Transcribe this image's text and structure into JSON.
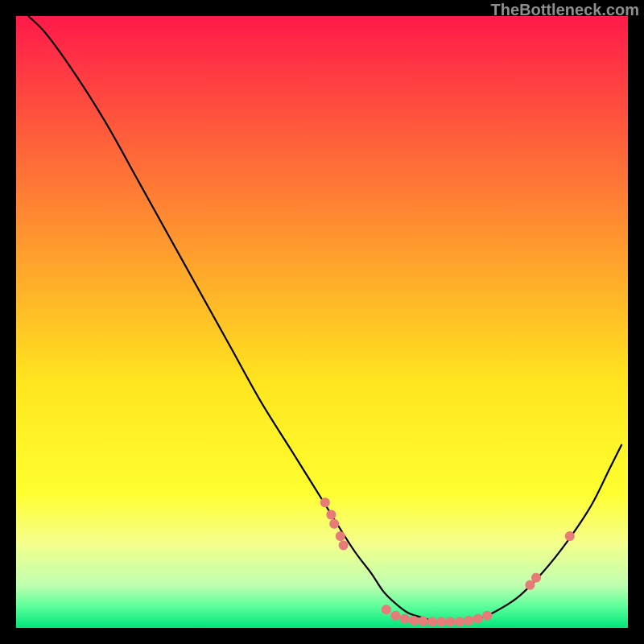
{
  "watermark": "TheBottleneck.com",
  "chart_data": {
    "type": "line",
    "title": "",
    "xlabel": "",
    "ylabel": "",
    "xlim": [
      0,
      100
    ],
    "ylim": [
      0,
      100
    ],
    "grid": false,
    "legend": false,
    "background_gradient": {
      "stops": [
        {
          "offset": 0.0,
          "color": "#ff1a4a"
        },
        {
          "offset": 0.2,
          "color": "#ff5f3a"
        },
        {
          "offset": 0.4,
          "color": "#ffa22c"
        },
        {
          "offset": 0.6,
          "color": "#ffe61e"
        },
        {
          "offset": 0.78,
          "color": "#ffff30"
        },
        {
          "offset": 0.86,
          "color": "#f5ff8a"
        },
        {
          "offset": 0.93,
          "color": "#c0ffb0"
        },
        {
          "offset": 0.965,
          "color": "#5cff9c"
        },
        {
          "offset": 1.0,
          "color": "#00e57a"
        }
      ]
    },
    "series": [
      {
        "name": "bottleneck-curve",
        "color": "#000000",
        "x": [
          2,
          5,
          10,
          15,
          20,
          25,
          30,
          35,
          40,
          45,
          50,
          55,
          58,
          60,
          62,
          64,
          66,
          68,
          70,
          72,
          75,
          78,
          82,
          86,
          90,
          94,
          97,
          99
        ],
        "y": [
          100,
          97,
          90,
          82,
          73,
          64,
          55,
          46,
          37,
          29,
          21,
          13,
          9,
          6,
          4,
          2.5,
          1.8,
          1.2,
          1,
          1,
          1.3,
          2.5,
          5,
          9,
          14,
          20,
          26,
          30
        ]
      }
    ],
    "scatter_points": {
      "name": "data-points",
      "color": "#e77b78",
      "radius": 6,
      "points": [
        {
          "x": 50.5,
          "y": 20.5
        },
        {
          "x": 51.5,
          "y": 18.5
        },
        {
          "x": 52.0,
          "y": 17.0
        },
        {
          "x": 53.0,
          "y": 15.0
        },
        {
          "x": 53.5,
          "y": 13.5
        },
        {
          "x": 60.5,
          "y": 3.0
        },
        {
          "x": 62.0,
          "y": 2.0
        },
        {
          "x": 63.5,
          "y": 1.5
        },
        {
          "x": 65.0,
          "y": 1.2
        },
        {
          "x": 66.5,
          "y": 1.1
        },
        {
          "x": 68.0,
          "y": 1.0
        },
        {
          "x": 69.5,
          "y": 1.0
        },
        {
          "x": 71.0,
          "y": 1.0
        },
        {
          "x": 72.5,
          "y": 1.0
        },
        {
          "x": 74.0,
          "y": 1.2
        },
        {
          "x": 75.5,
          "y": 1.5
        },
        {
          "x": 77.0,
          "y": 2.0
        },
        {
          "x": 84.0,
          "y": 7.0
        },
        {
          "x": 85.0,
          "y": 8.2
        },
        {
          "x": 90.5,
          "y": 15.0
        }
      ]
    }
  }
}
